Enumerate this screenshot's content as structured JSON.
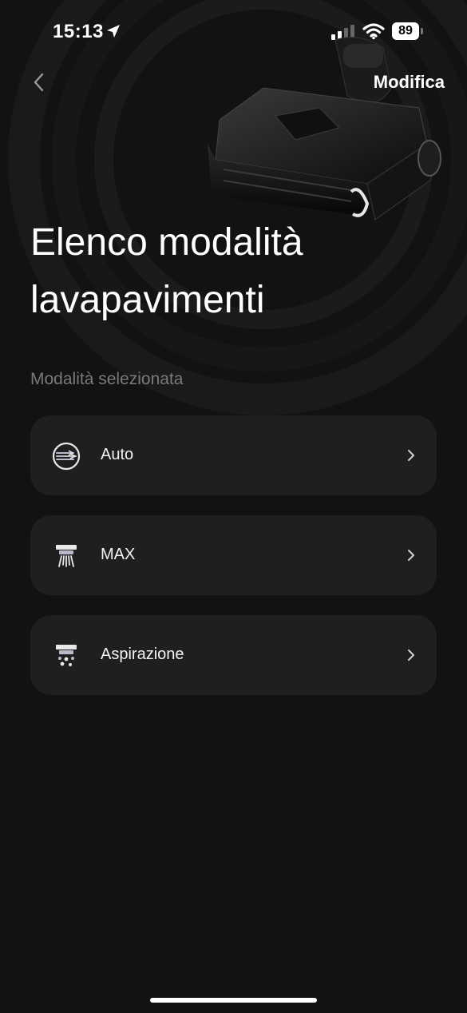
{
  "status_bar": {
    "time": "15:13",
    "battery": "89"
  },
  "header": {
    "edit_label": "Modifica"
  },
  "page": {
    "title_line1": "Elenco modalità",
    "title_line2": "lavapavimenti",
    "section_label": "Modalità selezionata"
  },
  "modes": [
    {
      "label": "Auto",
      "icon": "auto-mode-icon"
    },
    {
      "label": "MAX",
      "icon": "max-mode-icon"
    },
    {
      "label": "Aspirazione",
      "icon": "suction-mode-icon"
    }
  ],
  "colors": {
    "background": "#121212",
    "card": "#1f1f1f",
    "section_label": "#7a7a7a",
    "text": "#ffffff"
  }
}
